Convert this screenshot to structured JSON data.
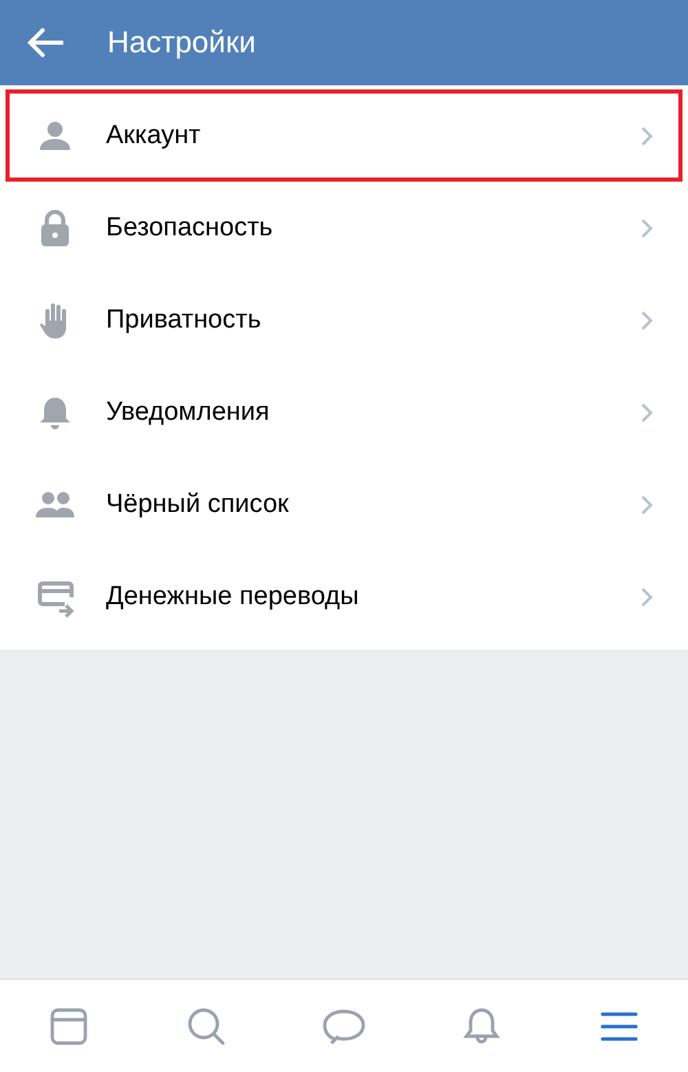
{
  "header": {
    "title": "Настройки"
  },
  "items": [
    {
      "label": "Аккаунт",
      "kind": "account",
      "highlighted": true
    },
    {
      "label": "Безопасность",
      "kind": "security",
      "highlighted": false
    },
    {
      "label": "Приватность",
      "kind": "privacy",
      "highlighted": false
    },
    {
      "label": "Уведомления",
      "kind": "notifications",
      "highlighted": false
    },
    {
      "label": "Чёрный список",
      "kind": "blacklist",
      "highlighted": false
    },
    {
      "label": "Денежные переводы",
      "kind": "transfers",
      "highlighted": false
    }
  ],
  "nav": [
    {
      "kind": "news",
      "selected": false
    },
    {
      "kind": "search",
      "selected": false
    },
    {
      "kind": "messages",
      "selected": false
    },
    {
      "kind": "notifications",
      "selected": false
    },
    {
      "kind": "menu",
      "selected": true
    }
  ]
}
